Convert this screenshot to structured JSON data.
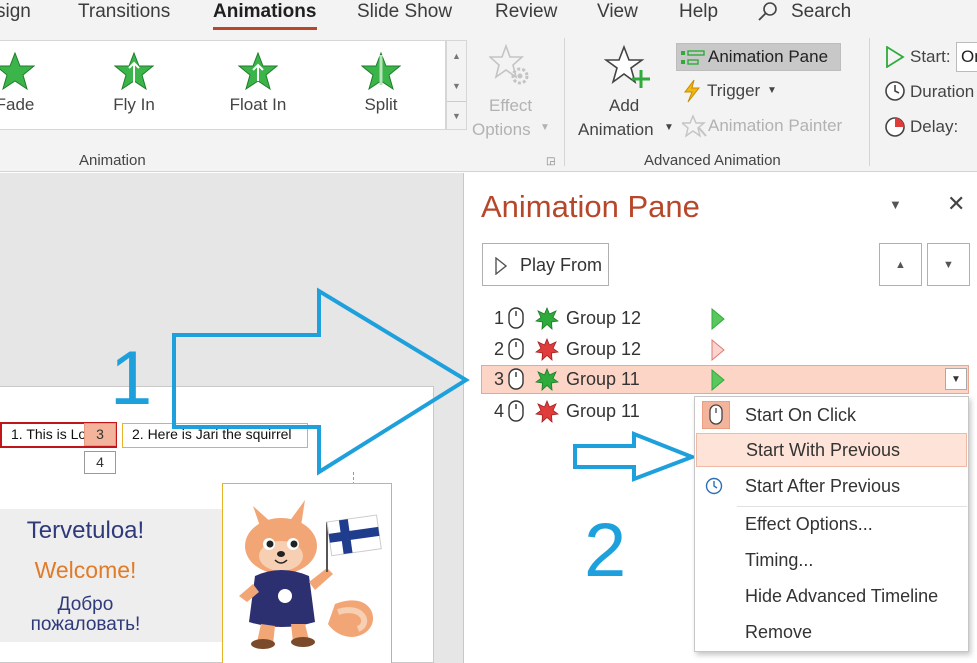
{
  "tabs": [
    {
      "label": "sign",
      "active": false
    },
    {
      "label": "Transitions",
      "active": false
    },
    {
      "label": "Animations",
      "active": true
    },
    {
      "label": "Slide Show",
      "active": false
    },
    {
      "label": "Review",
      "active": false
    },
    {
      "label": "View",
      "active": false
    },
    {
      "label": "Help",
      "active": false
    }
  ],
  "search_label": "Search",
  "ribbon": {
    "animation_gallery": [
      "Fade",
      "Fly In",
      "Float In",
      "Split"
    ],
    "effect_options": [
      "Effect",
      "Options"
    ],
    "group_animation": "Animation",
    "add_animation": [
      "Add",
      "Animation"
    ],
    "animation_pane_label": "Animation Pane",
    "trigger_label": "Trigger",
    "animation_painter_label": "Animation Painter",
    "group_advanced": "Advanced Animation",
    "timing": {
      "start_label": "Start:",
      "start_value": "On",
      "duration_label": "Duration",
      "delay_label": "Delay:"
    }
  },
  "pane": {
    "title": "Animation Pane",
    "play_from_label": "Play From",
    "rows": [
      {
        "num": "1",
        "effect": "entrance",
        "name": "Group 12",
        "bar": "solid",
        "selected": false
      },
      {
        "num": "2",
        "effect": "exit",
        "name": "Group 12",
        "bar": "outline",
        "selected": false
      },
      {
        "num": "3",
        "effect": "entrance",
        "name": "Group 11",
        "bar": "solid",
        "selected": true
      },
      {
        "num": "4",
        "effect": "exit",
        "name": "Group 11",
        "bar": "none",
        "selected": false
      }
    ]
  },
  "context_menu": [
    {
      "label": "Start On Click",
      "icon": "mouse-icon"
    },
    {
      "label": "Start With Previous",
      "icon": "",
      "hover": true
    },
    {
      "label": "Start After Previous",
      "icon": "clock-icon"
    },
    {
      "label": "Effect Options...",
      "icon": ""
    },
    {
      "label": "Timing...",
      "icon": ""
    },
    {
      "label": "Hide Advanced Timeline",
      "icon": ""
    },
    {
      "label": "Remove",
      "icon": ""
    }
  ],
  "annotations": {
    "step1": "1",
    "step2": "2"
  },
  "slide": {
    "caption1": "1. This is Lo",
    "caption2": "2. Here is Jari the squirrel",
    "tag3": "3",
    "tag4": "4",
    "welcome_fi": "Tervetuloa!",
    "welcome_en": "Welcome!",
    "welcome_ru_1": "Добро",
    "welcome_ru_2": "пожаловать!"
  },
  "colors": {
    "accent": "#b7472a",
    "arrow": "#1ea0dc",
    "entrance_green": "#2eab3a",
    "exit_red": "#e03c3c",
    "selection": "#fcd5c7"
  }
}
